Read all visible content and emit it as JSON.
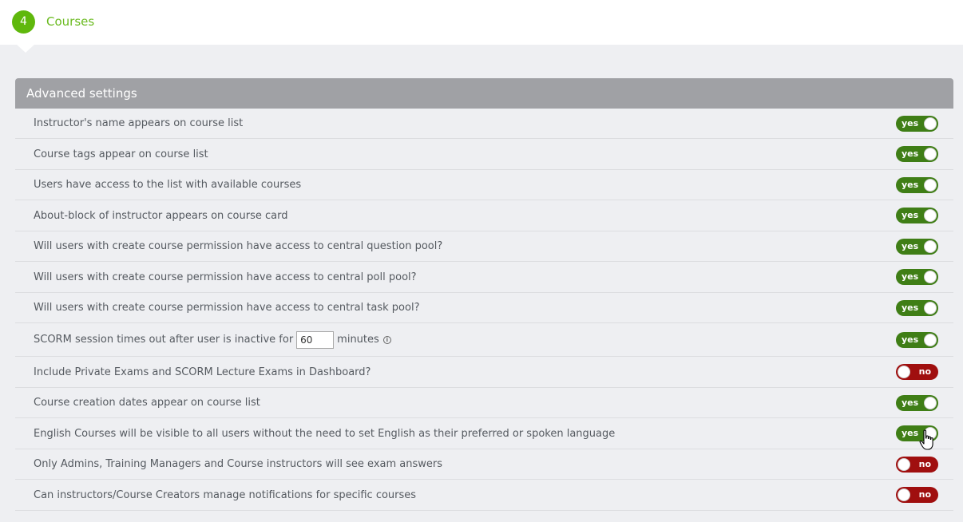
{
  "step": {
    "number": "4",
    "title": "Courses"
  },
  "panel": {
    "title": "Advanced settings"
  },
  "settings": [
    {
      "label": "Instructor's name appears on course list",
      "state": "yes"
    },
    {
      "label": "Course tags appear on course list",
      "state": "yes"
    },
    {
      "label": "Users have access to the list with available courses",
      "state": "yes"
    },
    {
      "label": "About-block of instructor appears on course card",
      "state": "yes"
    },
    {
      "label": "Will users with create course permission have access to central question pool?",
      "state": "yes"
    },
    {
      "label": "Will users with create course permission have access to central poll pool?",
      "state": "yes"
    },
    {
      "label": "Will users with create course permission have access to central task pool?",
      "state": "yes"
    },
    {
      "label_before": "SCORM session times out after user is inactive for",
      "input_value": "60",
      "label_after": "minutes",
      "state": "yes"
    },
    {
      "label": "Include Private Exams and SCORM Lecture Exams in Dashboard?",
      "state": "no"
    },
    {
      "label": "Course creation dates appear on course list",
      "state": "yes"
    },
    {
      "label": "English Courses will be visible to all users without the need to set English as their preferred or spoken language",
      "state": "yes"
    },
    {
      "label": "Only Admins, Training Managers and Course instructors will see exam answers",
      "state": "no"
    },
    {
      "label": "Can instructors/Course Creators manage notifications for specific courses",
      "state": "no"
    }
  ],
  "colors": {
    "accent": "#5fb80c",
    "toggle_on": "#3f7e16",
    "toggle_off": "#a00f0f",
    "header": "#a0a1a5"
  }
}
